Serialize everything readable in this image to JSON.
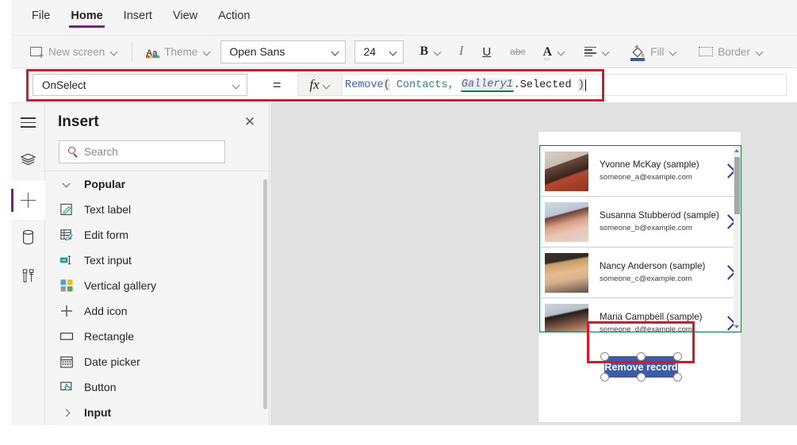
{
  "menubar": {
    "items": [
      {
        "label": "File",
        "active": false
      },
      {
        "label": "Home",
        "active": true
      },
      {
        "label": "Insert",
        "active": false
      },
      {
        "label": "View",
        "active": false
      },
      {
        "label": "Action",
        "active": false
      }
    ]
  },
  "ribbon": {
    "new_screen": "New screen",
    "theme": "Theme",
    "font_name": "Open Sans",
    "font_size": "24",
    "bold": "B",
    "italic": "I",
    "underline": "U",
    "strikethrough": "abc",
    "font_color": "A",
    "align": "align",
    "fill": "Fill",
    "border": "Border"
  },
  "formula_bar": {
    "property": "OnSelect",
    "equals": "=",
    "fx": "fx",
    "formula": {
      "fn": "Remove",
      "open_paren": "(",
      "space1": " ",
      "table": "Contacts,",
      "space2": " ",
      "control": "Gallery1",
      "property_ref": ".Selected",
      "space3": " ",
      "close_paren": ")"
    },
    "formula_plain": "Remove( Contacts, Gallery1.Selected )"
  },
  "rail": {
    "items": [
      {
        "name": "menu",
        "icon": "hamburger-icon",
        "active": false
      },
      {
        "name": "tree",
        "icon": "layers-icon",
        "active": false
      },
      {
        "name": "insert",
        "icon": "plus-icon",
        "active": true
      },
      {
        "name": "data",
        "icon": "database-icon",
        "active": false
      },
      {
        "name": "media",
        "icon": "tools-icon",
        "active": false
      }
    ]
  },
  "insert_panel": {
    "title": "Insert",
    "close": "✕",
    "search_placeholder": "Search",
    "search_value": "",
    "sections": [
      {
        "label": "Popular",
        "expanded": true,
        "items": [
          {
            "label": "Text label",
            "icon": "text-label-icon"
          },
          {
            "label": "Edit form",
            "icon": "edit-form-icon"
          },
          {
            "label": "Text input",
            "icon": "text-input-icon"
          },
          {
            "label": "Vertical gallery",
            "icon": "vertical-gallery-icon"
          },
          {
            "label": "Add icon",
            "icon": "add-icon"
          },
          {
            "label": "Rectangle",
            "icon": "rectangle-icon"
          },
          {
            "label": "Date picker",
            "icon": "date-picker-icon"
          },
          {
            "label": "Button",
            "icon": "button-icon"
          }
        ]
      },
      {
        "label": "Input",
        "expanded": false,
        "items": []
      }
    ]
  },
  "canvas": {
    "gallery": {
      "name": "Gallery1",
      "selected_index": 0,
      "items": [
        {
          "name": "Yvonne McKay (sample)",
          "email": "someone_a@example.com",
          "face": "face1"
        },
        {
          "name": "Susanna Stubberod (sample)",
          "email": "someone_b@example.com",
          "face": "face2"
        },
        {
          "name": "Nancy Anderson (sample)",
          "email": "someone_c@example.com",
          "face": "face3"
        },
        {
          "name": "Maria Campbell (sample)",
          "email": "someone_d@example.com",
          "face": "face4"
        }
      ]
    },
    "button": {
      "label": "Remove record",
      "fill": "#3b5ca8",
      "text_color": "#ffffff",
      "selected": true
    }
  },
  "colors": {
    "accent_purple": "#742774",
    "highlight_red": "#e81123",
    "selection_green": "#107c41",
    "formula_function": "#2b63c7",
    "formula_table": "#1a8a8a",
    "formula_control": "#6b4fb8",
    "button_fill": "#3b5ca8"
  }
}
